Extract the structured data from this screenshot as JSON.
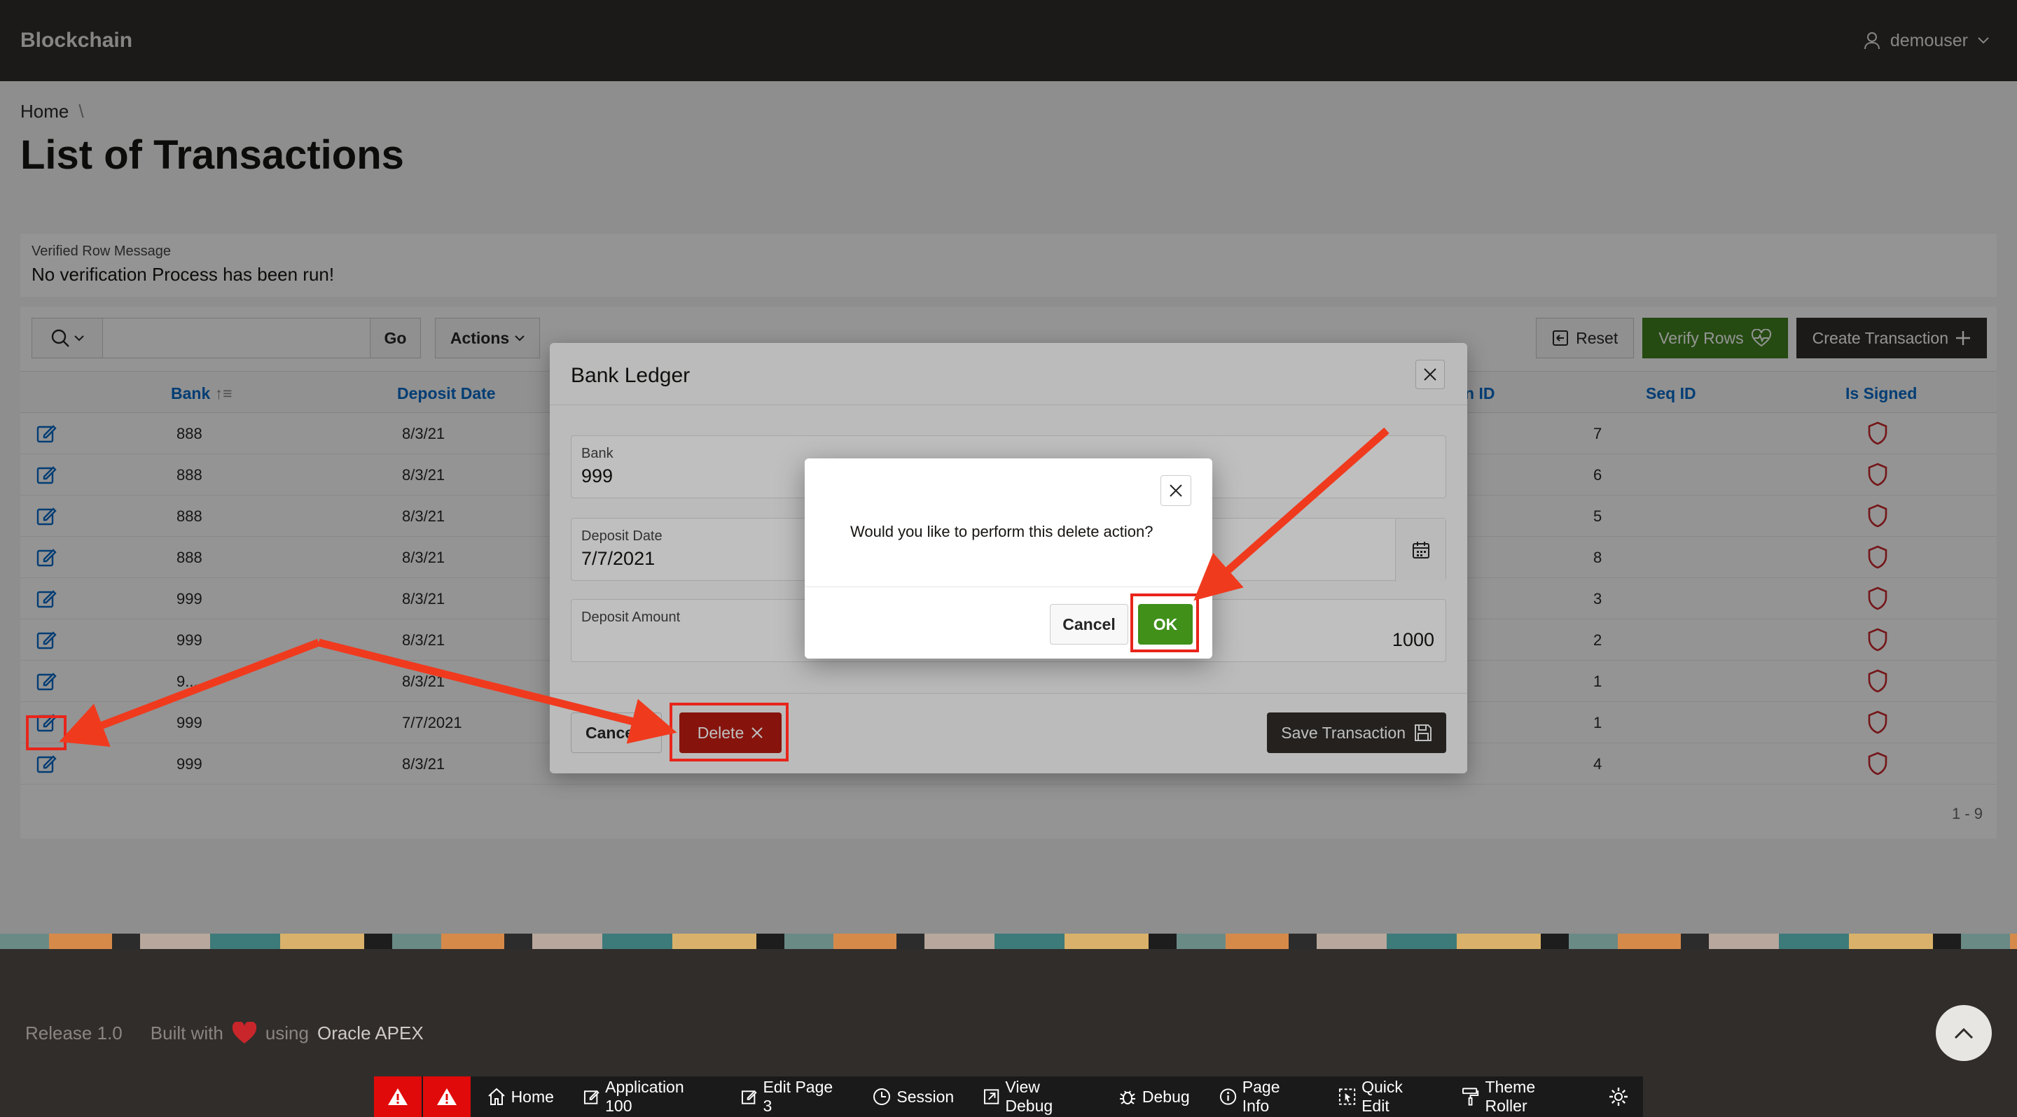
{
  "header": {
    "app_title": "Blockchain",
    "user": "demouser"
  },
  "breadcrumb": {
    "home": "Home",
    "sep": "\\"
  },
  "page_title": "List of Transactions",
  "message": {
    "label": "Verified Row Message",
    "value": "No verification Process has been run!"
  },
  "toolbar": {
    "go": "Go",
    "actions": "Actions",
    "reset": "Reset",
    "verify": "Verify Rows",
    "create": "Create Transaction"
  },
  "columns": {
    "bank": "Bank",
    "deposit_date": "Deposit Date",
    "tid": "n ID",
    "seq": "Seq ID",
    "signed": "Is Signed"
  },
  "rows": [
    {
      "bank": "888",
      "date": "8/3/21",
      "seq": "7"
    },
    {
      "bank": "888",
      "date": "8/3/21",
      "seq": "6"
    },
    {
      "bank": "888",
      "date": "8/3/21",
      "seq": "5"
    },
    {
      "bank": "888",
      "date": "8/3/21",
      "seq": "8"
    },
    {
      "bank": "999",
      "date": "8/3/21",
      "seq": "3"
    },
    {
      "bank": "999",
      "date": "8/3/21",
      "seq": "2"
    },
    {
      "bank": "9...",
      "date": "8/3/21",
      "seq": "1"
    },
    {
      "bank": "999",
      "date": "7/7/2021",
      "seq": "1"
    },
    {
      "bank": "999",
      "date": "8/3/21",
      "seq": "4"
    }
  ],
  "pagination": "1 - 9",
  "dialog": {
    "title": "Bank Ledger",
    "bank_label": "Bank",
    "bank_value": "999",
    "date_label": "Deposit Date",
    "date_value": "7/7/2021",
    "amount_label": "Deposit Amount",
    "amount_value": "1000",
    "cancel": "Cancel",
    "delete": "Delete",
    "save": "Save Transaction"
  },
  "confirm": {
    "message": "Would you like to perform this delete action?",
    "cancel": "Cancel",
    "ok": "OK"
  },
  "footer": {
    "release": "Release 1.0",
    "built_with": "Built with",
    "using": "using",
    "apex": "Oracle APEX"
  },
  "devbar": {
    "home": "Home",
    "application": "Application 100",
    "edit_page": "Edit Page 3",
    "session": "Session",
    "view_debug": "View Debug",
    "debug": "Debug",
    "page_info": "Page Info",
    "quick_edit": "Quick Edit",
    "theme_roller": "Theme Roller"
  },
  "colors": {
    "highlight": "#e8251b",
    "ok_green": "#40901a",
    "delete_red": "#b31b12",
    "link_blue": "#056ac8"
  }
}
